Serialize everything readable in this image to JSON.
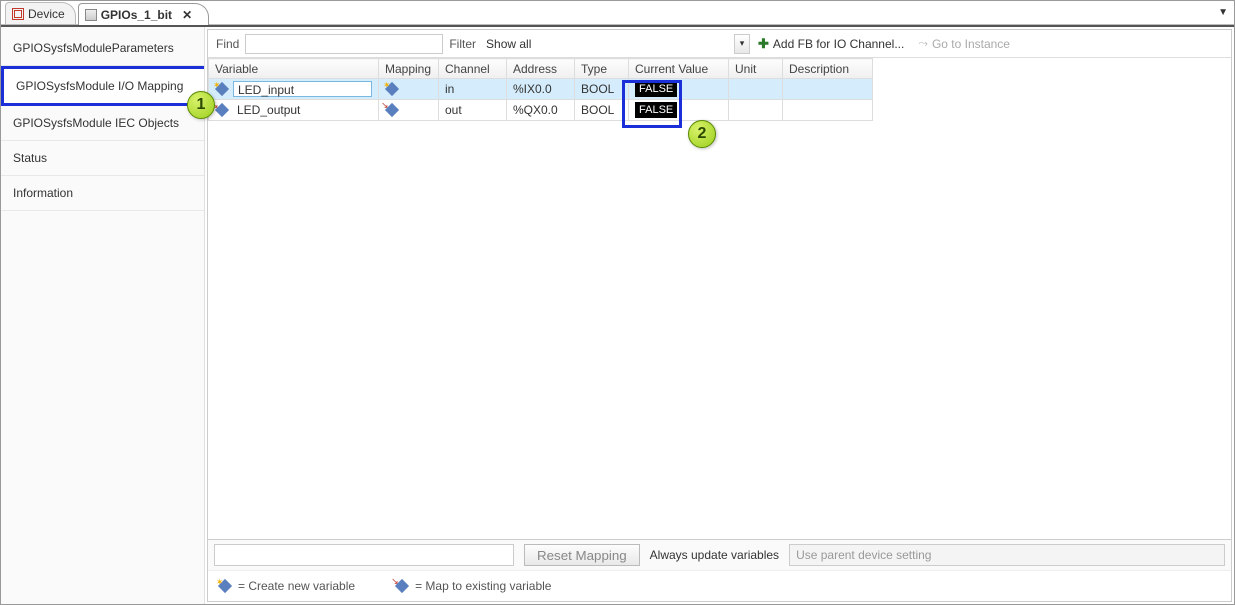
{
  "tabs": [
    {
      "label": "Device",
      "active": false
    },
    {
      "label": "GPIOs_1_bit",
      "active": true
    }
  ],
  "sidebar": {
    "items": [
      "GPIOSysfsModuleParameters",
      "GPIOSysfsModule I/O Mapping",
      "GPIOSysfsModule IEC Objects",
      "Status",
      "Information"
    ],
    "selected_index": 1
  },
  "toolbar": {
    "find_label": "Find",
    "find_value": "",
    "filter_label": "Filter",
    "filter_value": "Show all",
    "add_fb_label": "Add FB for IO Channel...",
    "go_instance_label": "Go to Instance"
  },
  "columns": {
    "variable": "Variable",
    "mapping": "Mapping",
    "channel": "Channel",
    "address": "Address",
    "type": "Type",
    "current_value": "Current Value",
    "unit": "Unit",
    "description": "Description"
  },
  "rows": [
    {
      "variable": "LED_input",
      "icon": "new-var",
      "mapping_icon": "new-var",
      "channel": "in",
      "address": "%IX0.0",
      "type": "BOOL",
      "current_value": "FALSE",
      "unit": "",
      "description": "",
      "selected": true
    },
    {
      "variable": "LED_output",
      "icon": "map-var",
      "mapping_icon": "map-var",
      "channel": "out",
      "address": "%QX0.0",
      "type": "BOOL",
      "current_value": "FALSE",
      "unit": "",
      "description": "",
      "selected": false
    }
  ],
  "status": {
    "reset_label": "Reset Mapping",
    "always_update_label": "Always update variables",
    "combo_value": "Use parent device setting"
  },
  "legend": {
    "create": "= Create new variable",
    "map": "= Map to existing variable"
  },
  "callouts": {
    "one": "1",
    "two": "2"
  }
}
